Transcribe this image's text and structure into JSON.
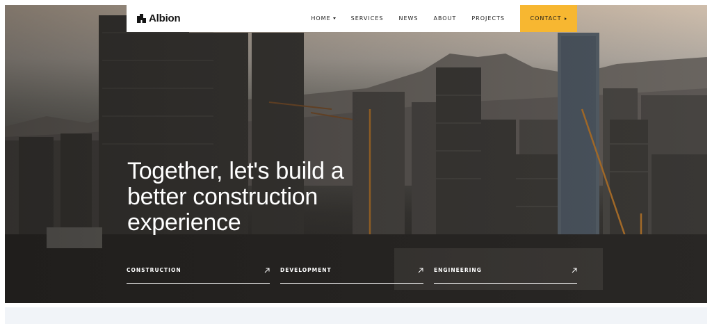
{
  "brand": {
    "name": "Albion",
    "logo_icon": "building-icon"
  },
  "nav": {
    "items": [
      {
        "label": "HOME",
        "has_dropdown": true
      },
      {
        "label": "SERVICES"
      },
      {
        "label": "NEWS"
      },
      {
        "label": "ABOUT"
      },
      {
        "label": "PROJECTS"
      }
    ],
    "contact_label": "CONTACT",
    "contact_color": "#f7b731"
  },
  "hero": {
    "headline_lines": [
      "Together, let's build a",
      "better construction",
      "experience"
    ]
  },
  "services": [
    {
      "label": "CONSTRUCTION",
      "icon": "arrow-up-right-icon"
    },
    {
      "label": "DEVELOPMENT",
      "icon": "arrow-up-right-icon"
    },
    {
      "label": "ENGINEERING",
      "icon": "arrow-up-right-icon"
    }
  ]
}
